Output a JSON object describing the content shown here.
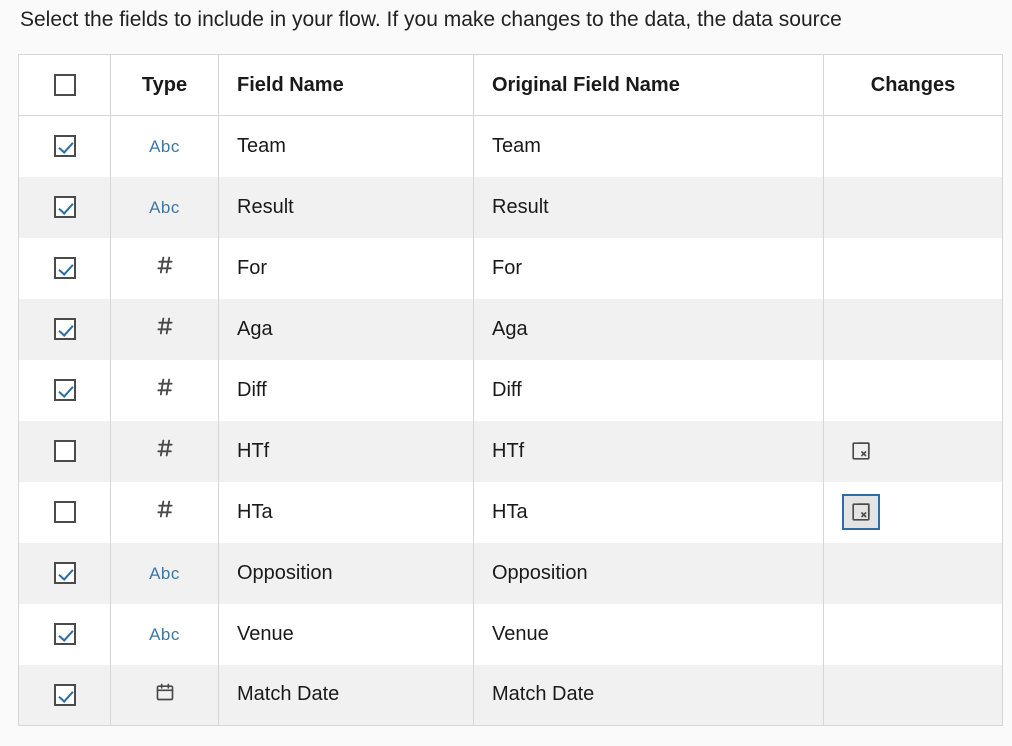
{
  "instruction": "Select the fields to include in your flow. If you make changes to the data, the data source",
  "headers": {
    "type": "Type",
    "field_name": "Field Name",
    "original_field_name": "Original Field Name",
    "changes": "Changes"
  },
  "type_labels": {
    "string": "Abc",
    "number": "#",
    "date": "date"
  },
  "rows": [
    {
      "checked": true,
      "type": "string",
      "field_name": "Team",
      "original_field_name": "Team",
      "change": null,
      "change_active": false
    },
    {
      "checked": true,
      "type": "string",
      "field_name": "Result",
      "original_field_name": "Result",
      "change": null,
      "change_active": false
    },
    {
      "checked": true,
      "type": "number",
      "field_name": "For",
      "original_field_name": "For",
      "change": null,
      "change_active": false
    },
    {
      "checked": true,
      "type": "number",
      "field_name": "Aga",
      "original_field_name": "Aga",
      "change": null,
      "change_active": false
    },
    {
      "checked": true,
      "type": "number",
      "field_name": "Diff",
      "original_field_name": "Diff",
      "change": null,
      "change_active": false
    },
    {
      "checked": false,
      "type": "number",
      "field_name": "HTf",
      "original_field_name": "HTf",
      "change": "removed",
      "change_active": false
    },
    {
      "checked": false,
      "type": "number",
      "field_name": "HTa",
      "original_field_name": "HTa",
      "change": "removed",
      "change_active": true
    },
    {
      "checked": true,
      "type": "string",
      "field_name": "Opposition",
      "original_field_name": "Opposition",
      "change": null,
      "change_active": false
    },
    {
      "checked": true,
      "type": "string",
      "field_name": "Venue",
      "original_field_name": "Venue",
      "change": null,
      "change_active": false
    },
    {
      "checked": true,
      "type": "date",
      "field_name": "Match Date",
      "original_field_name": "Match Date",
      "change": null,
      "change_active": false
    }
  ]
}
